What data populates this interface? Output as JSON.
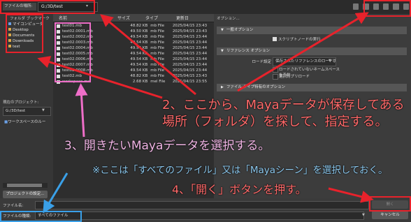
{
  "topbar": {
    "lookin_label": "ファイルの場所:",
    "path": "G:/3D/test",
    "tool_icons": [
      "back-icon",
      "forward-icon",
      "up-icon",
      "new-folder-icon",
      "list-view-icon",
      "detail-view-icon"
    ]
  },
  "sidebar": {
    "favorites_label": "フォルダ ブックマーク",
    "favorites": [
      {
        "label": "マイコンピュータ",
        "icon": "computer-icon"
      },
      {
        "label": "Desktop",
        "icon": "folder-icon"
      },
      {
        "label": "Documents",
        "icon": "folder-icon"
      },
      {
        "label": "Downloads",
        "icon": "folder-icon"
      },
      {
        "label": "test",
        "icon": "folder-icon"
      }
    ],
    "project_label": "現在のプロジェクト:",
    "project_value": "G:/3D/test",
    "workspace_label": "ワークスペースのルー",
    "project_settings_button": "プロジェクトの設定..."
  },
  "file_list": {
    "columns": [
      "名前",
      "サイズ",
      "タイプ",
      "更新日"
    ],
    "rows": [
      {
        "name": "test01.mb",
        "size": "48.82 KB",
        "type": "mb File",
        "date": "2025/04/15 23:43"
      },
      {
        "name": "test02.0001.mb",
        "size": "49.50 KB",
        "type": "mb File",
        "date": "2025/04/15 23:43"
      },
      {
        "name": "test02.0002.mb",
        "size": "49.54 KB",
        "type": "mb File",
        "date": "2025/04/15 23:44"
      },
      {
        "name": "test02.0003.mb",
        "size": "49.54 KB",
        "type": "mb File",
        "date": "2025/04/15 23:44"
      },
      {
        "name": "test02.0004.mb",
        "size": "49.54 KB",
        "type": "mb File",
        "date": "2025/04/15 23:44"
      },
      {
        "name": "test02.0005.mb",
        "size": "49.54 KB",
        "type": "mb File",
        "date": "2025/04/15 23:44"
      },
      {
        "name": "test02.0006.mb",
        "size": "49.54 KB",
        "type": "mb File",
        "date": "2025/04/15 23:44"
      },
      {
        "name": "test02.0007.mb",
        "size": "49.54 KB",
        "type": "mb File",
        "date": "2025/04/15 23:44"
      },
      {
        "name": "test02.0008.mb",
        "size": "49.54 KB",
        "type": "mb File",
        "date": "2025/04/15 23:44"
      },
      {
        "name": "test02.mb",
        "size": "48.82 KB",
        "type": "mb File",
        "date": "2025/04/15 23:43"
      },
      {
        "name": "workspace.mel",
        "size": "2.68 KB",
        "type": "mel File",
        "date": "2025/04/15 23:55"
      }
    ]
  },
  "options": {
    "label": "オプション...",
    "general_section": "一般オプション",
    "script_checkbox": "スクリプトノードの実行",
    "reference_section": "リファレンス オプション",
    "load_label": "ロード設定",
    "load_value": "保存されたリファレンスのロード状態をロード",
    "namespace_checkbox": "ロードされていないネームスペースを予約",
    "selective_checkbox": "選択的プリロード",
    "filetype_section": "ファイル タイプ特有のオプション"
  },
  "bottom": {
    "filename_label": "ファイル名:",
    "filename_value": "",
    "open_button": "開く",
    "filetype_label": "ファイルの種類:",
    "filetype_value": "すべてのファイル",
    "cancel_button": "キャンセル"
  },
  "annotations": {
    "step2_line1": "2、ここから、Mayaデータが保存してある",
    "step2_line2": "場所（フォルダ）を探して、指定する。",
    "step3": "3、開きたいMayaデータを選択する。",
    "note": "※ここは「すべてのファイル」又は「Mayaシーン」を選択しておく。",
    "step4": "4、「開く」ボタンを押す。"
  },
  "colors": {
    "annotation_red": "#e8222b",
    "annotation_pink": "#ee6ec8",
    "annotation_blue": "#3aa0e8",
    "background": "#3c3c3c"
  }
}
